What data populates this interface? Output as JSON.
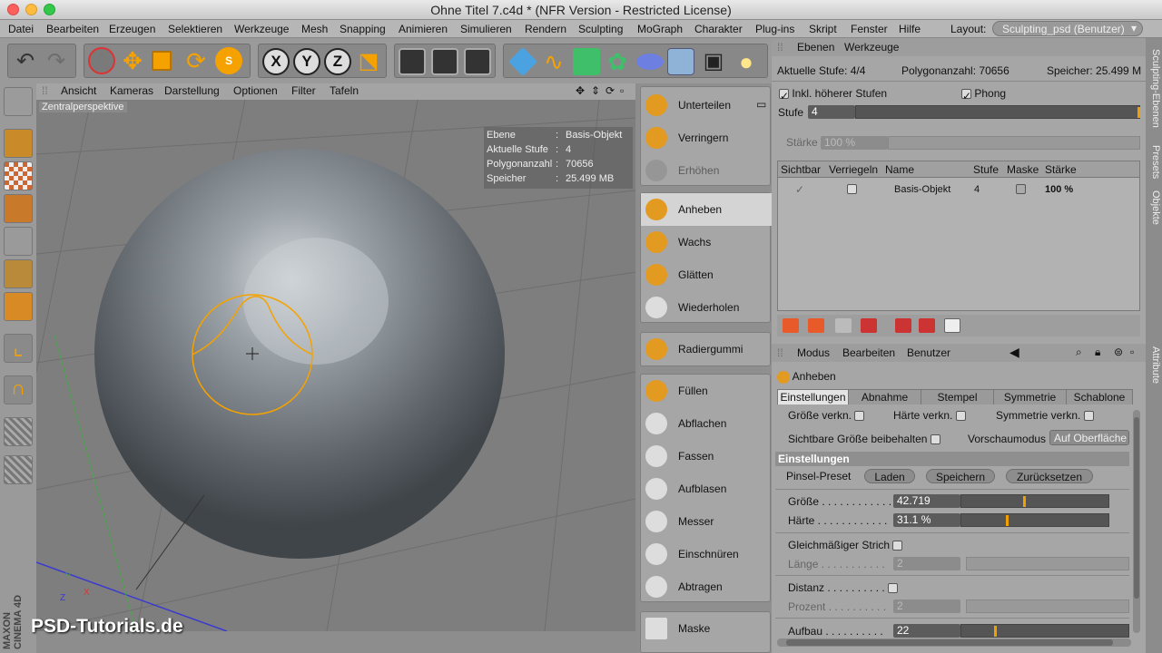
{
  "window": {
    "title": "Ohne Titel 7.c4d * (NFR Version - Restricted License)"
  },
  "menu": [
    "Datei",
    "Bearbeiten",
    "Erzeugen",
    "Selektieren",
    "Werkzeuge",
    "Mesh",
    "Snapping",
    "Animieren",
    "Simulieren",
    "Rendern",
    "Sculpting",
    "MoGraph",
    "Charakter",
    "Plug-ins",
    "Skript",
    "Fenster",
    "Hilfe"
  ],
  "layout": {
    "label": "Layout:",
    "value": "Sculpting_psd (Benutzer)"
  },
  "viewport": {
    "menu": [
      "Ansicht",
      "Kameras",
      "Darstellung",
      "Optionen",
      "Filter",
      "Tafeln"
    ],
    "camera_label": "Zentralperspektive",
    "hud": [
      {
        "key": "Ebene",
        "value": "Basis-Objekt"
      },
      {
        "key": "Aktuelle Stufe",
        "value": "4"
      },
      {
        "key": "Polygonanzahl",
        "value": "70656"
      },
      {
        "key": "Speicher",
        "value": "25.499 MB"
      }
    ],
    "axis": {
      "x": "X",
      "y": "Y",
      "z": "Z"
    },
    "watermark": "PSD-Tutorials.de",
    "brand": "MAXON CINEMA 4D"
  },
  "brushes": {
    "group1": [
      "Unterteilen",
      "Verringern",
      "Erhöhen"
    ],
    "group2": [
      "Anheben",
      "Wachs",
      "Glätten",
      "Wiederholen"
    ],
    "group3": [
      "Radiergummi"
    ],
    "group4": [
      "Füllen",
      "Abflachen",
      "Fassen",
      "Aufblasen",
      "Messer",
      "Einschnüren",
      "Abtragen"
    ],
    "group5": [
      "Maske"
    ]
  },
  "layers": {
    "tabs": [
      "Ebenen",
      "Werkzeuge"
    ],
    "current_level_label": "Aktuelle Stufe: 4/4",
    "polycount_label": "Polygonanzahl: 70656",
    "memory_label": "Speicher: 25.499 M",
    "incl_higher": "Inkl. höherer Stufen",
    "phong": "Phong",
    "stufe_label": "Stufe",
    "stufe_value": "4",
    "staerke_label": "Stärke",
    "staerke_value": "100 %",
    "columns": [
      "Sichtbar",
      "Verriegeln",
      "Name",
      "Stufe",
      "Maske",
      "Stärke"
    ],
    "row": {
      "name": "Basis-Objekt",
      "stufe": "4",
      "staerke": "100 %"
    }
  },
  "attributes": {
    "menu": [
      "Modus",
      "Bearbeiten",
      "Benutzer"
    ],
    "tool_name": "Anheben",
    "tabs": [
      "Einstellungen",
      "Abnahme",
      "Stempel",
      "Symmetrie",
      "Schablone"
    ],
    "size_lock": "Größe verkn.",
    "hardness_lock": "Härte verkn.",
    "sym_lock": "Symmetrie verkn.",
    "keep_size": "Sichtbare Größe beibehalten",
    "preview_mode": "Vorschaumodus",
    "preview_value": "Auf Oberfläche",
    "section": "Einstellungen",
    "preset_label": "Pinsel-Preset",
    "load": "Laden",
    "save": "Speichern",
    "reset": "Zurücksetzen",
    "groesse_label": "Größe . . . . . . . . . . . .",
    "groesse_value": "42.719",
    "groesse_level": 0.43,
    "haerte_label": "Härte . . . . . . . . . . . .",
    "haerte_value": "31.1 %",
    "haerte_level": 0.31,
    "stroke_label": "Gleichmäßiger Strich",
    "laenge_label": "Länge . . . . . . . . . . .",
    "laenge_value": "2",
    "distanz_label": "Distanz . . . . . . . . . .",
    "prozent_label": "Prozent . . . . . . . . . .",
    "prozent_value": "2",
    "aufbau_label": "Aufbau . . . . . . . . . .",
    "aufbau_value": "22",
    "aufbau_level": 0.2
  },
  "side_tabs": [
    "Sculpting-Ebenen",
    "Presets",
    "Objekte",
    "Attribute"
  ]
}
